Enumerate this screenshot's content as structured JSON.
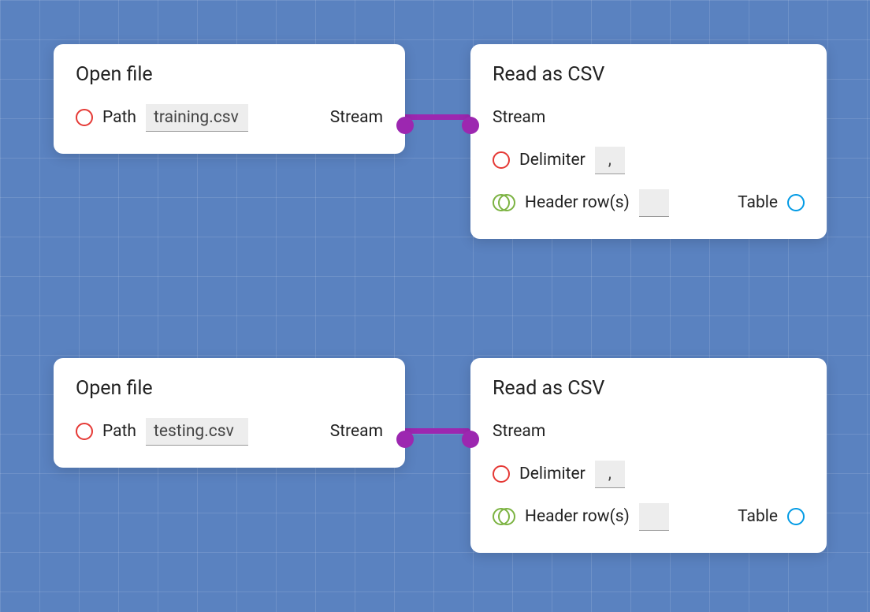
{
  "nodes": {
    "open1": {
      "title": "Open file",
      "path_label": "Path",
      "path_value": "training.csv",
      "stream_label": "Stream"
    },
    "csv1": {
      "title": "Read as CSV",
      "stream_label": "Stream",
      "delimiter_label": "Delimiter",
      "delimiter_value": ",",
      "header_label": "Header row(s)",
      "header_value": "",
      "table_label": "Table"
    },
    "open2": {
      "title": "Open file",
      "path_label": "Path",
      "path_value": "testing.csv",
      "stream_label": "Stream"
    },
    "csv2": {
      "title": "Read as CSV",
      "stream_label": "Stream",
      "delimiter_label": "Delimiter",
      "delimiter_value": ",",
      "header_label": "Header row(s)",
      "header_value": "",
      "table_label": "Table"
    }
  },
  "colors": {
    "accent_purple": "#9c27b0",
    "port_red": "#e53935",
    "port_green": "#7cb342",
    "port_blue": "#039be5",
    "canvas_bg": "#5a82c0"
  }
}
